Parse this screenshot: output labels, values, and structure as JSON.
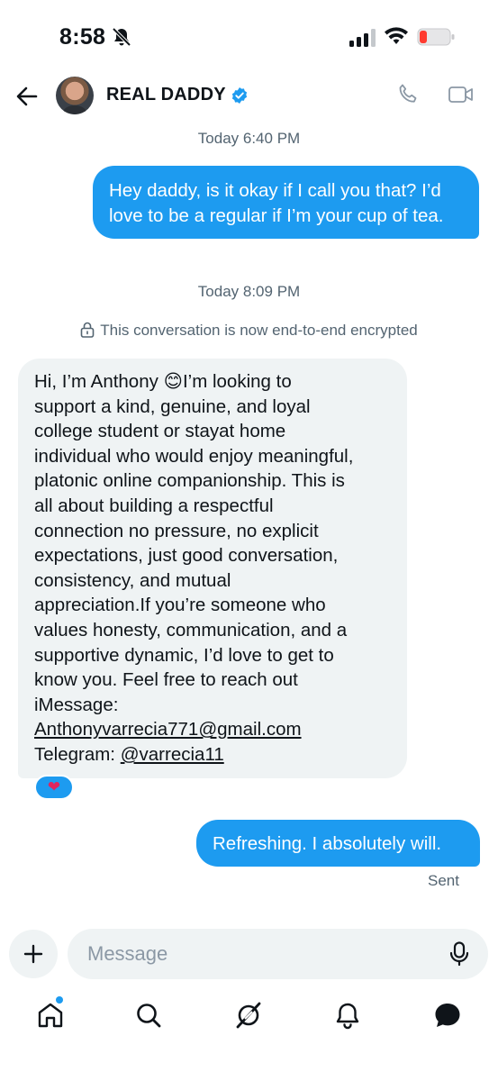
{
  "status_bar": {
    "time": "8:58"
  },
  "header": {
    "contact_name": "REAL DADDY"
  },
  "thread": {
    "timestamp_1": "Today 6:40 PM",
    "timestamp_2": "Today 8:09 PM",
    "encryption_notice": "This conversation is now end-to-end encrypted",
    "outgoing_1": "Hey daddy, is it okay if I call you that? I’d love to be a regular if I’m your cup of tea.",
    "incoming_lines": [
      "Hi, I’m Anthony",
      "I’m looking to",
      "support a kind, genuine, and loyal",
      "college student or stayat home",
      "individual who would enjoy meaningful,",
      "platonic online companionship. This is",
      "all about building a respectful",
      "connection no pressure, no explicit",
      "expectations, just good conversation,",
      "consistency, and mutual",
      "appreciation.If you’re someone who",
      "values honesty, communication, and a",
      "supportive dynamic, I’d love to get to",
      "know you.   Feel free to reach out",
      "iMessage:"
    ],
    "incoming_emoji": "😊",
    "incoming_email": "Anthonyvarrecia771@gmail.com",
    "incoming_telegram_label": "Telegram:",
    "incoming_telegram_handle": "@varrecia11",
    "reaction": "❤",
    "outgoing_2": "Refreshing. I absolutely will.",
    "delivery_status": "Sent"
  },
  "composer": {
    "placeholder": "Message"
  },
  "tabs": [
    "home",
    "search",
    "grok",
    "notifications",
    "messages"
  ],
  "colors": {
    "accent": "#1d9bf0",
    "incoming_bubble": "#eff3f4",
    "secondary_text": "#536471"
  }
}
